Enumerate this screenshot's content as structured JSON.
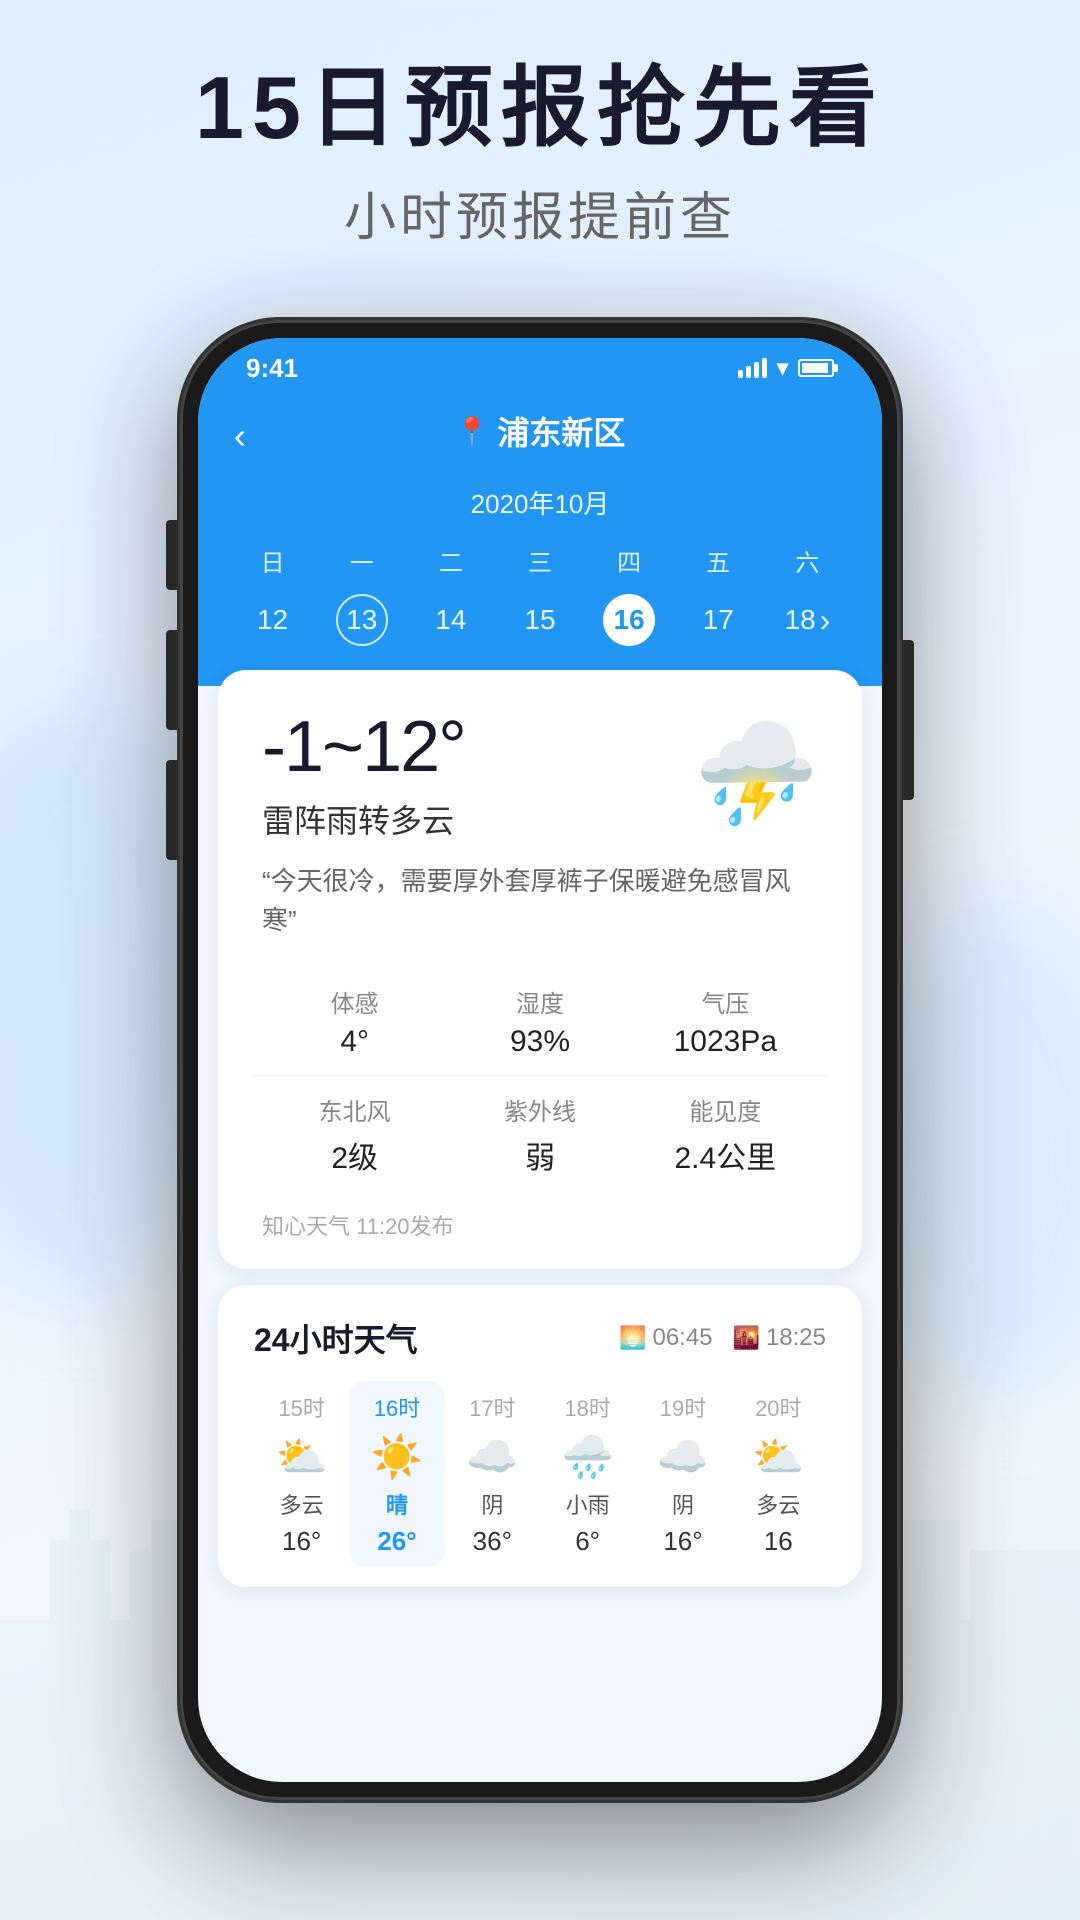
{
  "hero": {
    "title": "15日预报抢先看",
    "subtitle": "小时预报提前查"
  },
  "status_bar": {
    "time": "9:41"
  },
  "header": {
    "location": "浦东新区",
    "back_label": "‹"
  },
  "calendar": {
    "month": "2020年10月",
    "weekdays": [
      "日",
      "一",
      "二",
      "三",
      "四",
      "五",
      "六"
    ],
    "days": [
      {
        "num": "12",
        "state": "normal"
      },
      {
        "num": "13",
        "state": "ring"
      },
      {
        "num": "14",
        "state": "normal"
      },
      {
        "num": "15",
        "state": "normal"
      },
      {
        "num": "16",
        "state": "selected"
      },
      {
        "num": "17",
        "state": "normal"
      },
      {
        "num": "18",
        "state": "normal"
      }
    ],
    "next_arrow": "›"
  },
  "weather": {
    "temp_range": "-1~12°",
    "description": "雷阵雨转多云",
    "tip": "“今天很冷，需要厚外套厚裤子保暖避免感冒风寒”",
    "details": [
      {
        "label": "体感",
        "value": "4°"
      },
      {
        "label": "湿度",
        "value": "93%"
      },
      {
        "label": "气压",
        "value": "1023Pa"
      },
      {
        "label": "东北风",
        "value": "2级"
      },
      {
        "label": "紫外线",
        "value": "弱"
      },
      {
        "label": "能见度",
        "value": "2.4公里"
      }
    ],
    "publish": "知心天气 11:20发布"
  },
  "hourly": {
    "title": "24小时天气",
    "sunrise": "06:45",
    "sunset": "18:25",
    "hours": [
      {
        "time": "15时",
        "icon": "⛅",
        "desc": "多云",
        "temp": "16°",
        "active": false
      },
      {
        "time": "16时",
        "icon": "☀️",
        "desc": "晴",
        "temp": "26°",
        "active": true
      },
      {
        "time": "17时",
        "icon": "☁️",
        "desc": "阴",
        "temp": "36°",
        "active": false
      },
      {
        "time": "18时",
        "icon": "🌧️",
        "desc": "小雨",
        "temp": "6°",
        "active": false
      },
      {
        "time": "19时",
        "icon": "☁️",
        "desc": "阴",
        "temp": "16°",
        "active": false
      },
      {
        "time": "20时",
        "icon": "⛅",
        "desc": "多云",
        "temp": "16",
        "active": false
      }
    ]
  }
}
